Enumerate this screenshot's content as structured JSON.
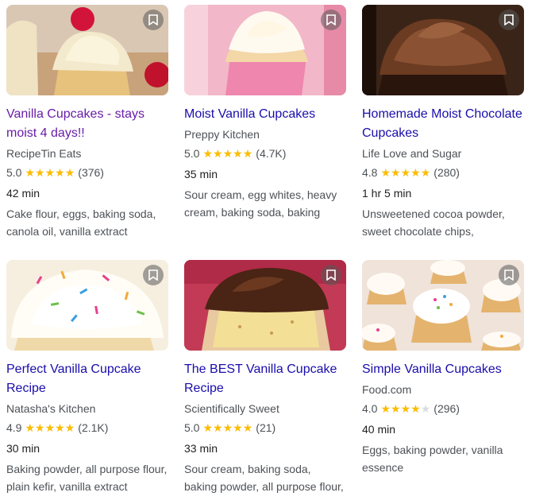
{
  "recipes": [
    {
      "title": "Vanilla Cupcakes - stays moist 4 days!!",
      "source": "RecipeTin Eats",
      "rating": "5.0",
      "stars": 5,
      "count": "(376)",
      "time": "42 min",
      "ingredients": "Cake flour, eggs, baking soda, canola oil, vanilla extract"
    },
    {
      "title": "Moist Vanilla Cupcakes",
      "source": "Preppy Kitchen",
      "rating": "5.0",
      "stars": 5,
      "count": "(4.7K)",
      "time": "35 min",
      "ingredients": "Sour cream, egg whites, heavy cream, baking soda, baking"
    },
    {
      "title": "Homemade Moist Chocolate Cupcakes",
      "source": "Life Love and Sugar",
      "rating": "4.8",
      "stars": 5,
      "count": "(280)",
      "time": "1 hr 5 min",
      "ingredients": "Unsweetened cocoa powder, sweet chocolate chips,"
    },
    {
      "title": "Perfect Vanilla Cupcake Recipe",
      "source": "Natasha's Kitchen",
      "rating": "4.9",
      "stars": 5,
      "count": "(2.1K)",
      "time": "30 min",
      "ingredients": "Baking powder, all purpose flour, plain kefir, vanilla extract"
    },
    {
      "title": "The BEST Vanilla Cupcake Recipe",
      "source": "Scientifically Sweet",
      "rating": "5.0",
      "stars": 5,
      "count": "(21)",
      "time": "33 min",
      "ingredients": "Sour cream, baking soda, baking powder, all purpose flour,"
    },
    {
      "title": "Simple Vanilla Cupcakes",
      "source": "Food.com",
      "rating": "4.0",
      "stars": 4,
      "count": "(296)",
      "time": "40 min",
      "ingredients": "Eggs, baking powder, vanilla essence"
    }
  ],
  "icons": {
    "save": "bookmark-icon",
    "star": "star-icon"
  },
  "colors": {
    "link": "#1a0dab",
    "visited_link": "#681da8",
    "star": "#fbbc04"
  }
}
